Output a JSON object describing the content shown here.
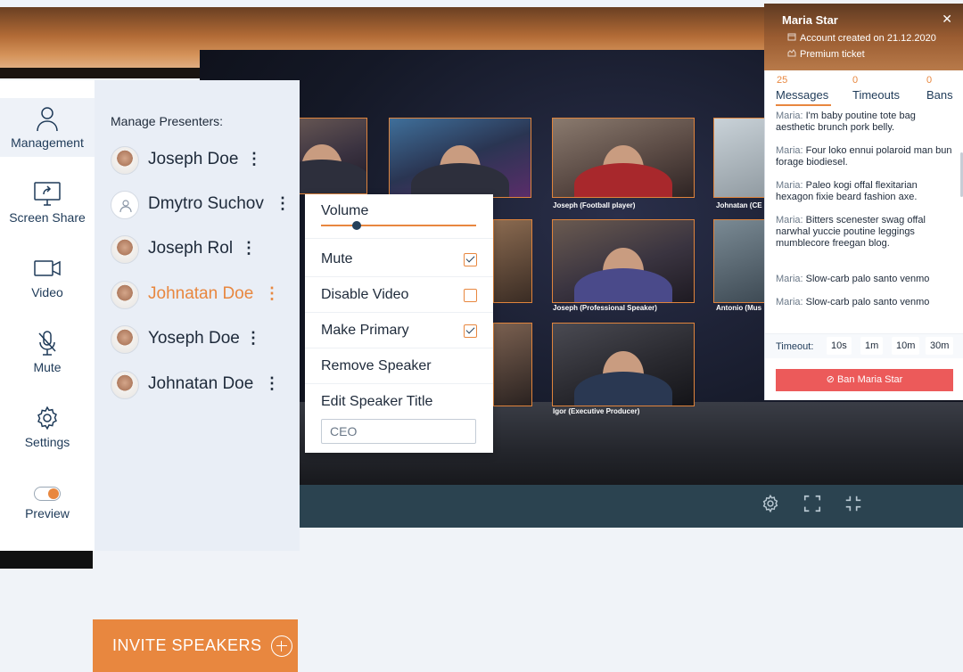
{
  "sidebar": {
    "items": [
      {
        "label": "Management",
        "icon": "user-icon"
      },
      {
        "label": "Screen Share",
        "icon": "screen-share-icon"
      },
      {
        "label": "Video",
        "icon": "video-camera-icon"
      },
      {
        "label": "Mute",
        "icon": "microphone-muted-icon"
      },
      {
        "label": "Settings",
        "icon": "gear-icon"
      },
      {
        "label": "Preview",
        "icon": "toggle-icon",
        "toggle_text": "ON"
      }
    ]
  },
  "presenters": {
    "title": "Manage Presenters:",
    "list": [
      {
        "name": "Joseph Doe"
      },
      {
        "name": "Dmytro Suchov"
      },
      {
        "name": "Joseph Rol"
      },
      {
        "name": "Johnatan Doe",
        "selected": true
      },
      {
        "name": "Yoseph Doe"
      },
      {
        "name": "Johnatan Doe"
      }
    ],
    "invite_label": "INVITE SPEAKERS"
  },
  "menu": {
    "volume_label": "Volume",
    "volume_level": 0.22,
    "mute_label": "Mute",
    "mute_checked": true,
    "disable_video_label": "Disable Video",
    "disable_video_checked": false,
    "make_primary_label": "Make Primary",
    "make_primary_checked": true,
    "remove_label": "Remove Speaker",
    "edit_title_label": "Edit Speaker Title",
    "title_value": "CEO"
  },
  "stage": {
    "captions": [
      "Joseph (Football player)",
      "Johnatan (CE",
      "Joseph (Professional Speaker)",
      "Antonio (Mus",
      "Igor (Executive Producer)"
    ],
    "controls": [
      "gear-icon",
      "fullscreen-icon",
      "exit-fullscreen-icon"
    ]
  },
  "profile": {
    "name": "Maria Star",
    "account_created": "Account created on 21.12.2020",
    "ticket": "Premium ticket",
    "stats": [
      {
        "count": "25",
        "label": "Messages"
      },
      {
        "count": "0",
        "label": "Timeouts"
      },
      {
        "count": "0",
        "label": "Bans"
      }
    ],
    "messages": [
      {
        "author": "Maria:",
        "text": "I'm baby poutine tote bag aesthetic brunch pork belly."
      },
      {
        "author": "Maria:",
        "text": "Four loko ennui polaroid man bun forage biodiesel."
      },
      {
        "author": "Maria:",
        "text": "Paleo kogi offal flexitarian hexagon fixie beard fashion axe."
      },
      {
        "author": "Maria:",
        "text": "Bitters scenester swag offal narwhal yuccie poutine leggings mumblecore freegan blog."
      },
      {
        "author": "Maria:",
        "text": "Slow-carb palo santo venmo"
      },
      {
        "author": "Maria:",
        "text": "Slow-carb palo santo venmo"
      }
    ],
    "timeout_label": "Timeout:",
    "timeout_options": [
      "10s",
      "1m",
      "10m",
      "30m"
    ],
    "ban_label": "Ban Maria Star"
  },
  "colors": {
    "accent": "#e8873f",
    "danger": "#ec5a5a",
    "navy": "#1e3a58"
  }
}
